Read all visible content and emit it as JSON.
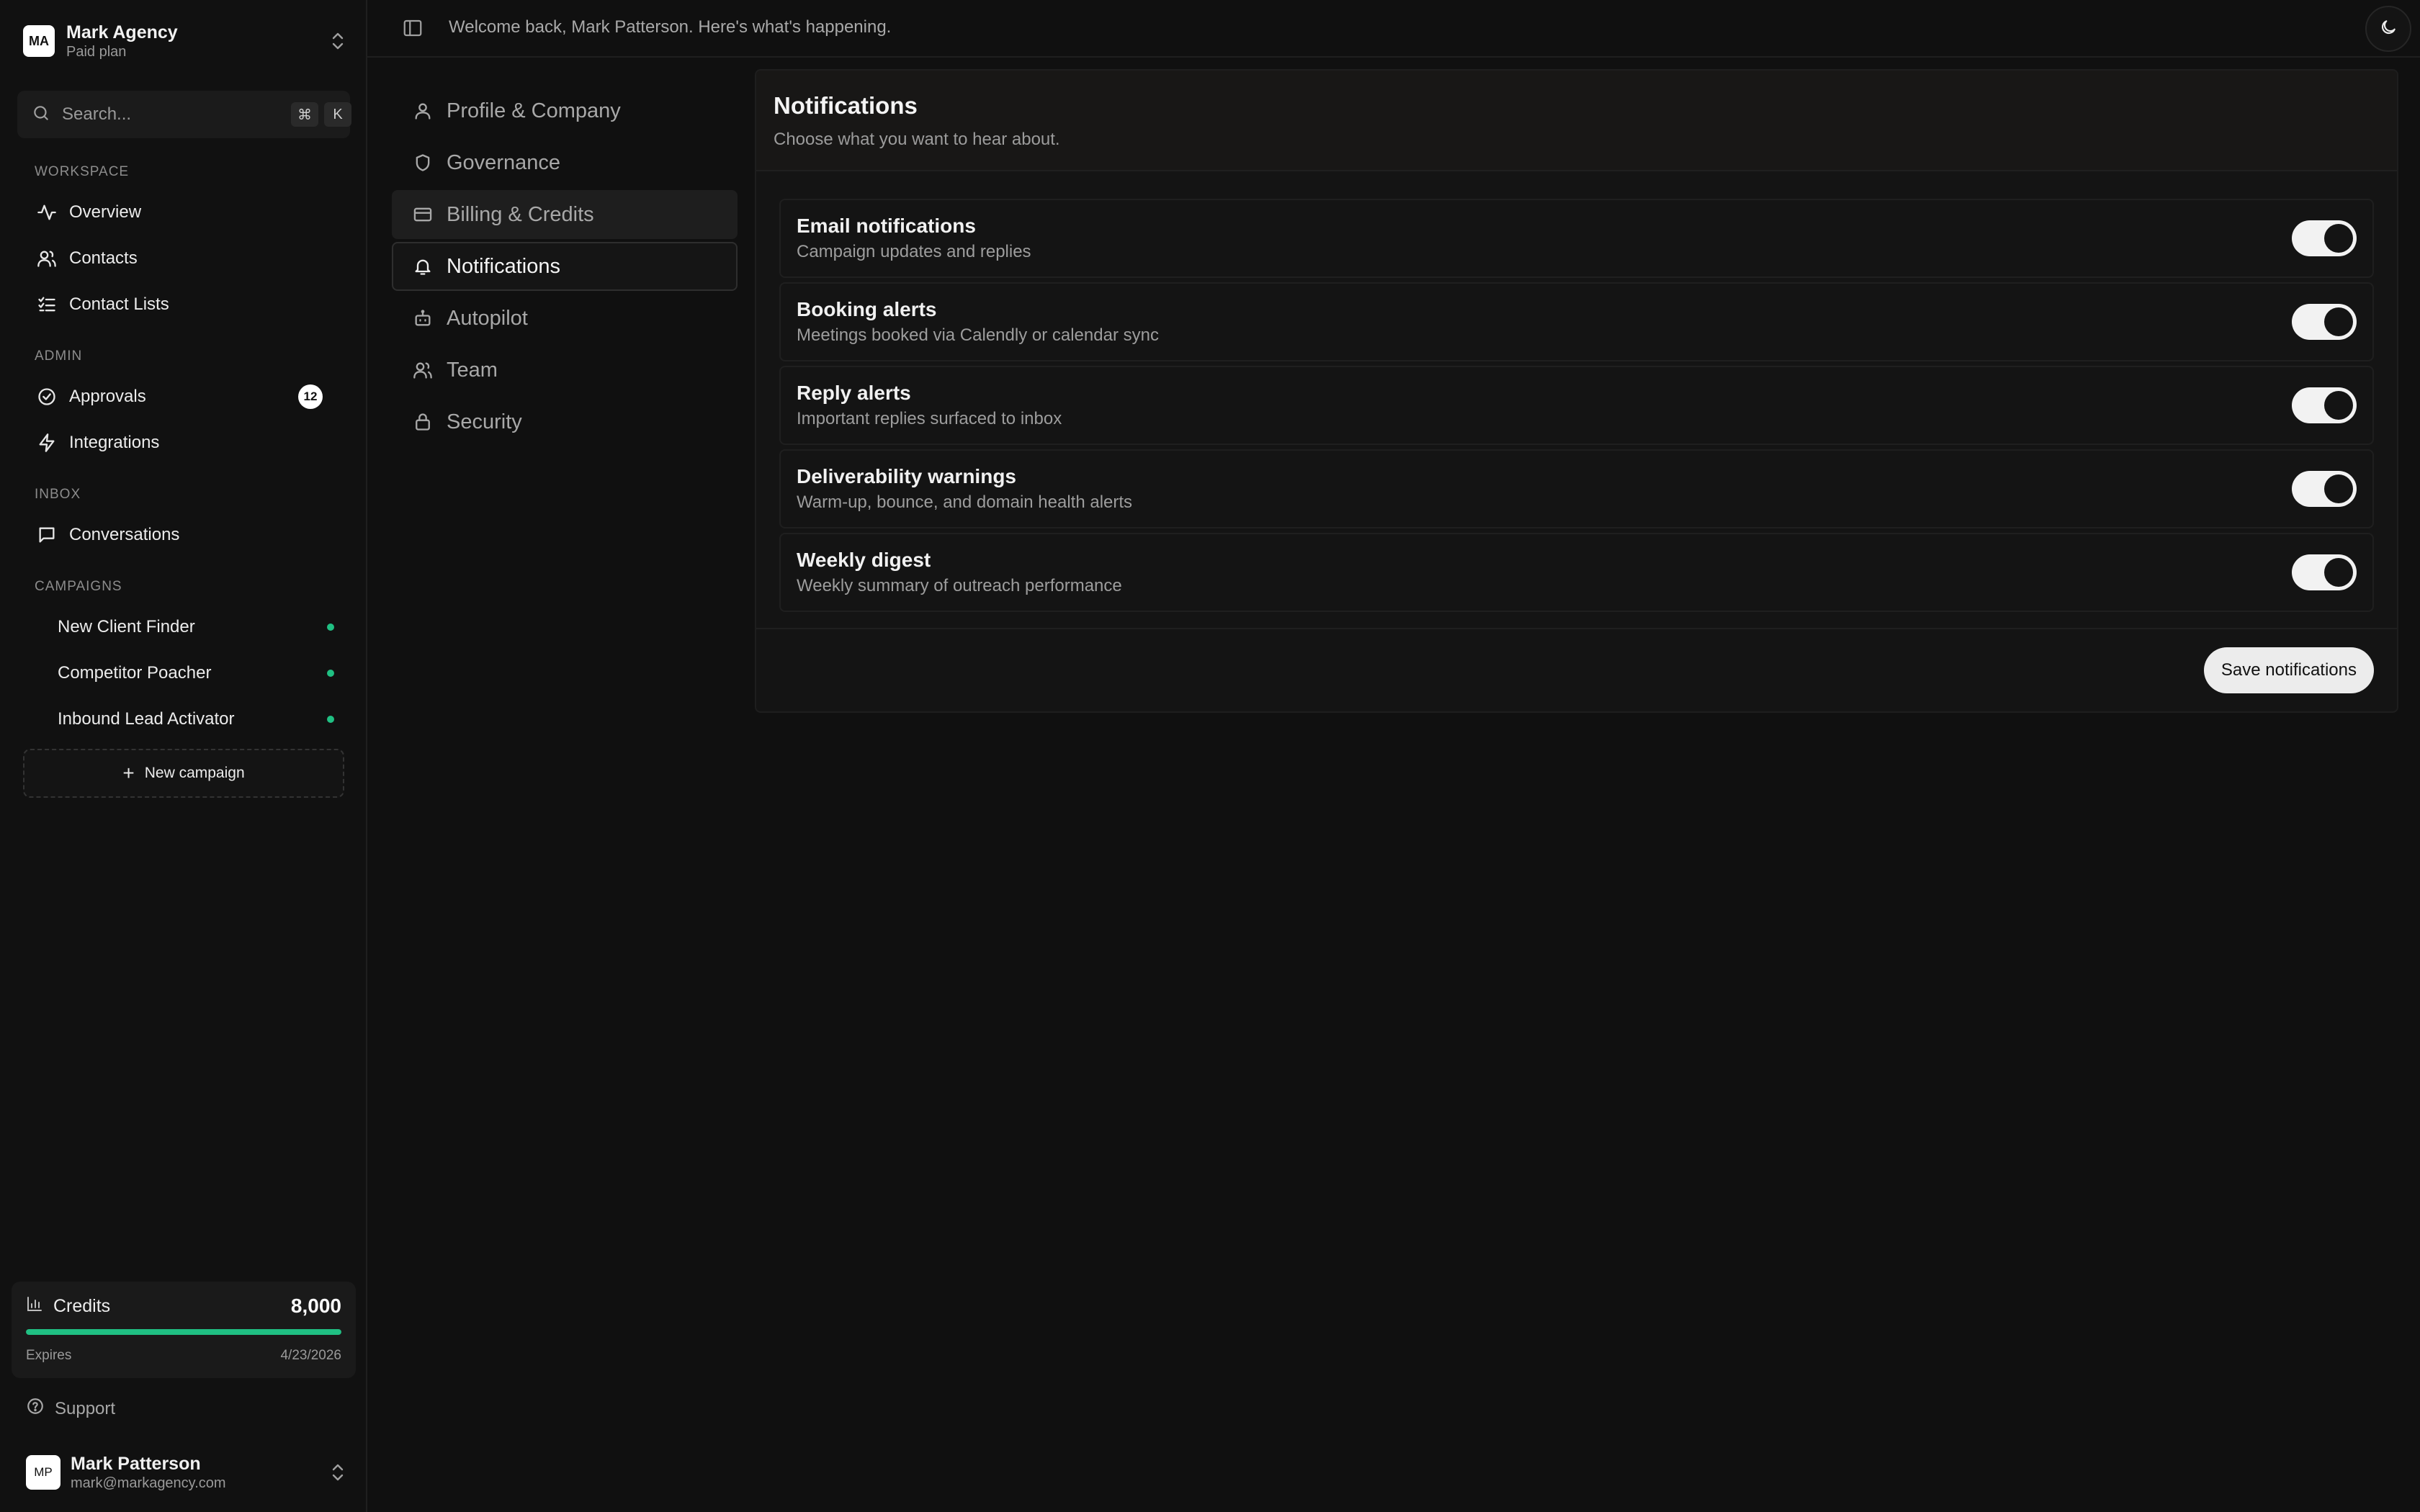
{
  "org": {
    "logo": "MA",
    "name": "Mark Agency",
    "plan": "Paid plan"
  },
  "search": {
    "placeholder": "Search...",
    "shortcut_mod": "⌘",
    "shortcut_key": "K"
  },
  "sidebar": {
    "sections": {
      "workspace": "WORKSPACE",
      "admin": "ADMIN",
      "inbox": "INBOX",
      "campaigns": "CAMPAIGNS"
    },
    "workspace_items": [
      {
        "label": "Overview",
        "icon": "activity-icon"
      },
      {
        "label": "Contacts",
        "icon": "users-icon"
      },
      {
        "label": "Contact Lists",
        "icon": "list-check-icon"
      }
    ],
    "admin_items": [
      {
        "label": "Approvals",
        "icon": "check-circle-icon",
        "badge": "12"
      },
      {
        "label": "Integrations",
        "icon": "zap-icon"
      }
    ],
    "inbox_items": [
      {
        "label": "Conversations",
        "icon": "message-square-icon"
      }
    ],
    "campaigns": [
      {
        "label": "New Client Finder",
        "status_color": "#20c083"
      },
      {
        "label": "Competitor Poacher",
        "status_color": "#20c083"
      },
      {
        "label": "Inbound Lead Activator",
        "status_color": "#20c083"
      }
    ],
    "new_campaign_label": "New campaign"
  },
  "credits": {
    "label": "Credits",
    "value": "8,000",
    "fill_fraction": 1.0,
    "expires_label": "Expires",
    "expires_date": "4/23/2026",
    "accent": "#20c083"
  },
  "support_label": "Support",
  "user": {
    "initials": "MP",
    "name": "Mark Patterson",
    "email": "mark@markagency.com"
  },
  "topbar": {
    "welcome": "Welcome back, Mark Patterson. Here's what's happening."
  },
  "settings_nav": [
    {
      "label": "Profile & Company",
      "icon": "user-icon",
      "state": ""
    },
    {
      "label": "Governance",
      "icon": "shield-icon",
      "state": ""
    },
    {
      "label": "Billing & Credits",
      "icon": "credit-card-icon",
      "state": "hover"
    },
    {
      "label": "Notifications",
      "icon": "bell-icon",
      "state": "active"
    },
    {
      "label": "Autopilot",
      "icon": "bot-icon",
      "state": ""
    },
    {
      "label": "Team",
      "icon": "users-icon",
      "state": ""
    },
    {
      "label": "Security",
      "icon": "lock-icon",
      "state": ""
    }
  ],
  "notifications": {
    "title": "Notifications",
    "subtitle": "Choose what you want to hear about.",
    "items": [
      {
        "title": "Email notifications",
        "desc": "Campaign updates and replies",
        "enabled": true
      },
      {
        "title": "Booking alerts",
        "desc": "Meetings booked via Calendly or calendar sync",
        "enabled": true
      },
      {
        "title": "Reply alerts",
        "desc": "Important replies surfaced to inbox",
        "enabled": true
      },
      {
        "title": "Deliverability warnings",
        "desc": "Warm-up, bounce, and domain health alerts",
        "enabled": true
      },
      {
        "title": "Weekly digest",
        "desc": "Weekly summary of outreach performance",
        "enabled": true
      }
    ],
    "save_label": "Save notifications"
  }
}
